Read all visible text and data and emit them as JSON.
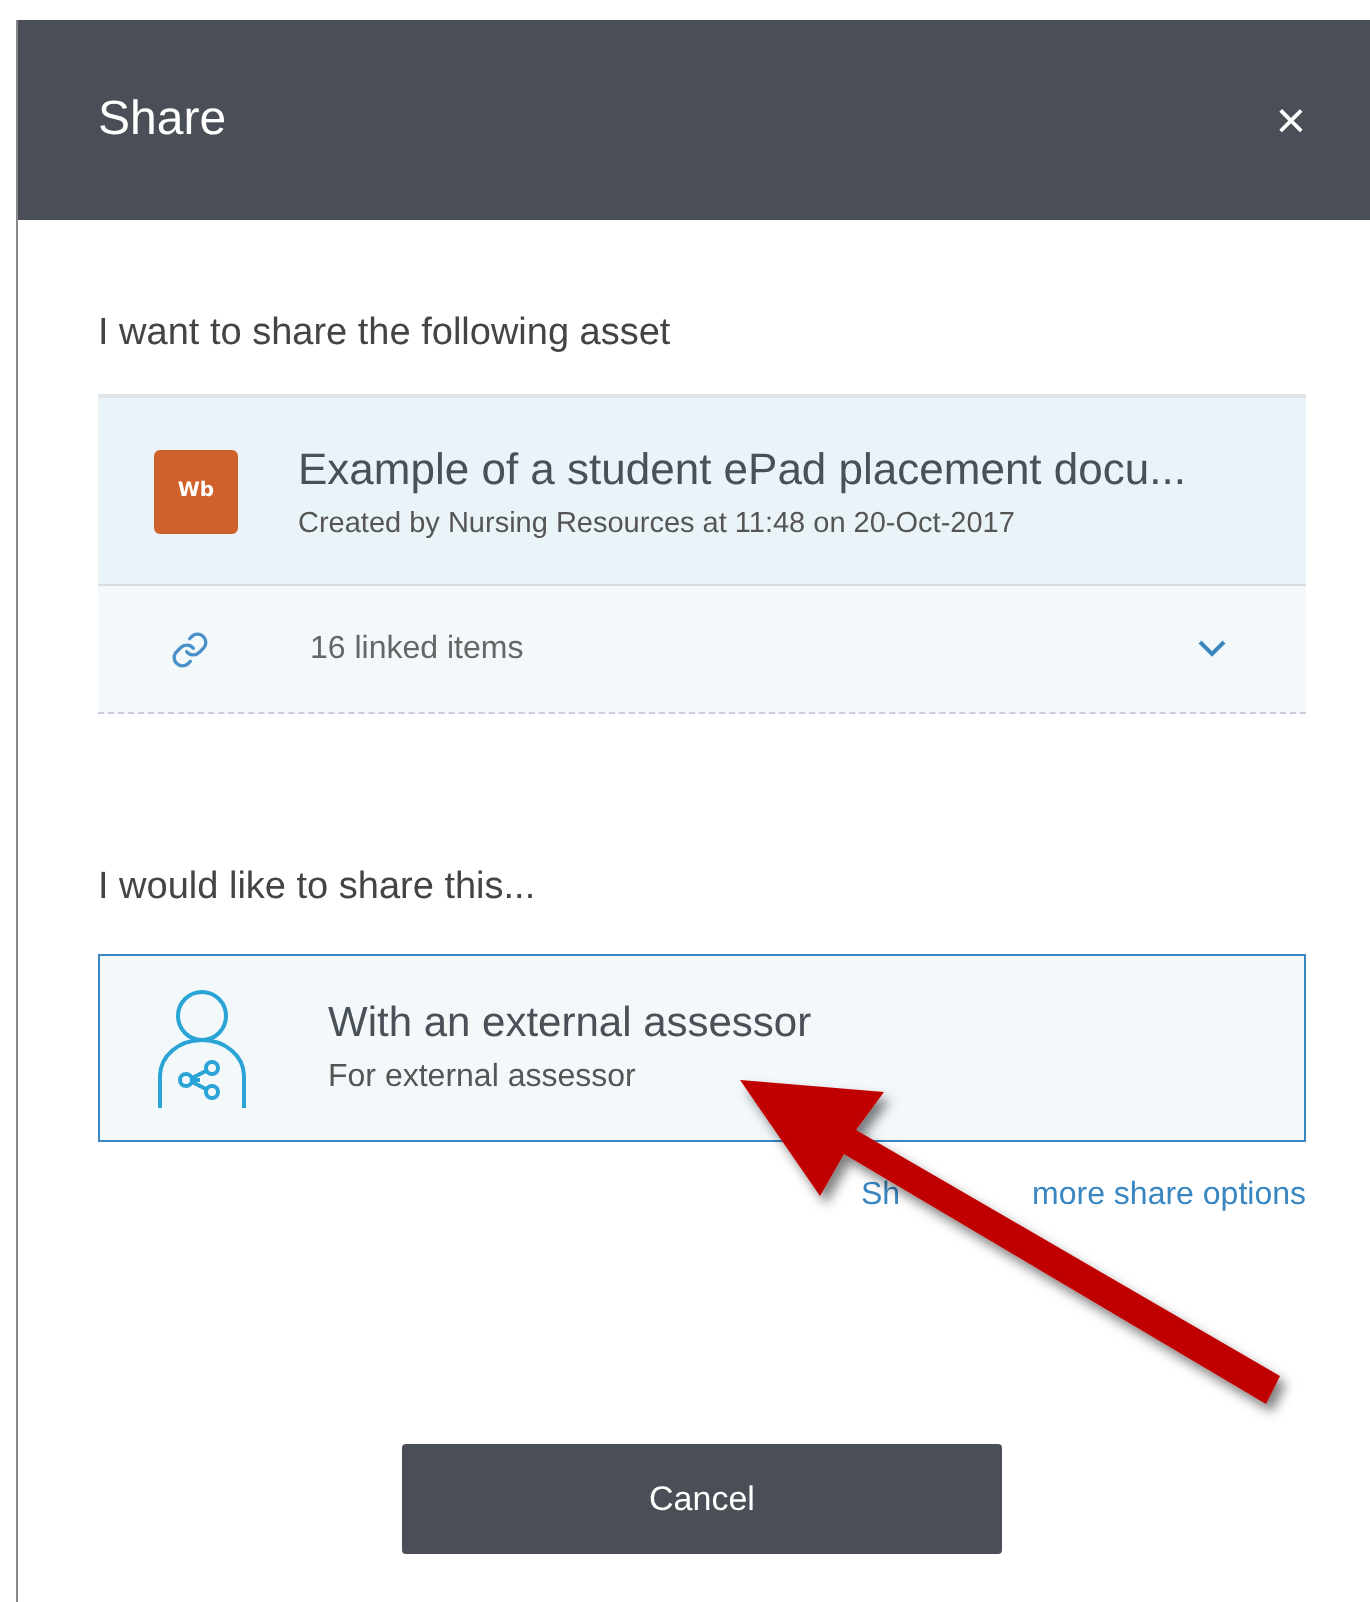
{
  "dialog": {
    "title": "Share",
    "close": "×"
  },
  "asset_section": {
    "heading": "I want to share the following asset",
    "asset": {
      "badge": "Wb",
      "color": "#d0612a",
      "title": "Example of a student ePad placement docu...",
      "subtitle": "Created by Nursing Resources at 11:48 on 20-Oct-2017"
    },
    "linked": {
      "label": "16 linked items",
      "expanded": false
    }
  },
  "share_section": {
    "heading": "I would like to share this...",
    "options": [
      {
        "title": "With an external assessor",
        "subtitle": "For external assessor",
        "selected": true
      }
    ],
    "more_link_start": "Sh",
    "more_link": "more share options"
  },
  "buttons": [
    {
      "label": "Cancel"
    }
  ]
}
